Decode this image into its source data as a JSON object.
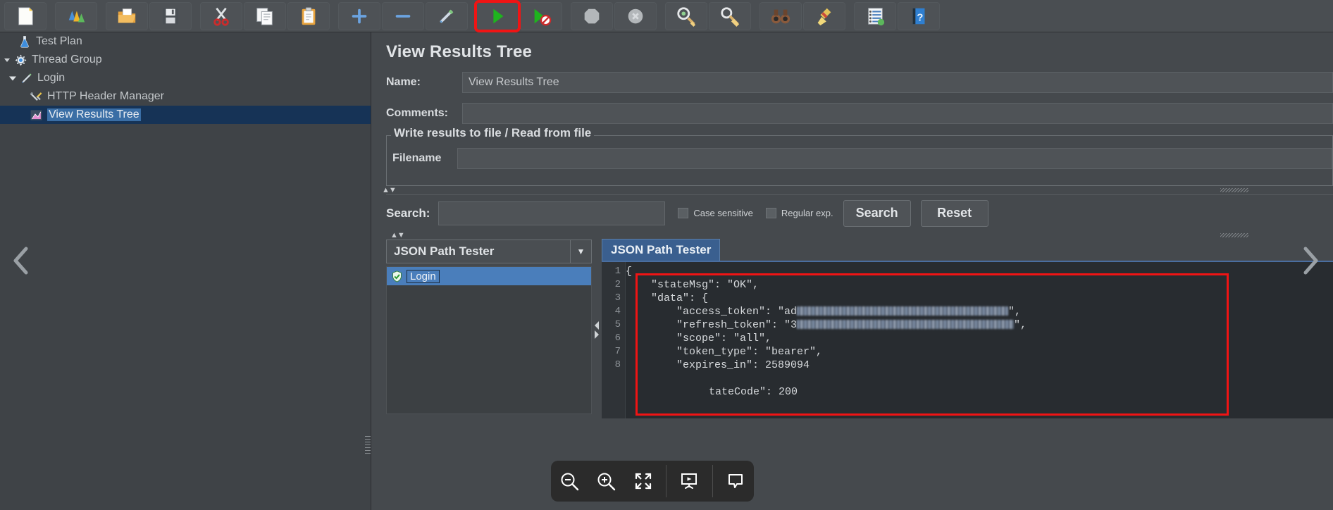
{
  "toolbar": {
    "buttons": [
      {
        "name": "new-test-plan",
        "icon": "new-document-icon"
      },
      {
        "name": "templates",
        "icon": "templates-icon"
      },
      {
        "name": "open",
        "icon": "open-folder-icon"
      },
      {
        "name": "save",
        "icon": "save-disk-icon"
      },
      {
        "name": "cut",
        "icon": "scissors-icon"
      },
      {
        "name": "copy",
        "icon": "copy-icon"
      },
      {
        "name": "paste",
        "icon": "clipboard-icon"
      },
      {
        "name": "expand-all",
        "icon": "plus-icon"
      },
      {
        "name": "collapse-all",
        "icon": "minus-icon"
      },
      {
        "name": "toggle",
        "icon": "toggle-pencil-icon"
      },
      {
        "name": "start",
        "icon": "play-green-icon",
        "highlighted": true
      },
      {
        "name": "start-no-pauses",
        "icon": "play-no-pauses-icon"
      },
      {
        "name": "stop",
        "icon": "stop-octagon-icon"
      },
      {
        "name": "shutdown",
        "icon": "shutdown-circle-icon"
      },
      {
        "name": "clear",
        "icon": "clear-broom-icon"
      },
      {
        "name": "clear-all",
        "icon": "clear-all-broom-icon"
      },
      {
        "name": "search",
        "icon": "binoculars-icon"
      },
      {
        "name": "reset-search",
        "icon": "broom-icon"
      },
      {
        "name": "function-helper",
        "icon": "function-list-icon"
      },
      {
        "name": "help",
        "icon": "help-book-icon"
      }
    ]
  },
  "tree": {
    "items": [
      {
        "label": "Test Plan",
        "icon": "test-plan-icon",
        "indent": 0,
        "twisty": "",
        "selected": false
      },
      {
        "label": "Thread Group",
        "icon": "thread-group-gear-icon",
        "indent": 0,
        "twisty": "down",
        "selected": false
      },
      {
        "label": "Login",
        "icon": "http-request-icon",
        "indent": 1,
        "twisty": "down",
        "selected": false
      },
      {
        "label": "HTTP Header Manager",
        "icon": "header-manager-icon",
        "indent": 2,
        "twisty": "",
        "selected": false
      },
      {
        "label": "View Results Tree",
        "icon": "view-results-tree-icon",
        "indent": 2,
        "twisty": "",
        "selected": true
      }
    ]
  },
  "panel": {
    "title": "View Results Tree",
    "name_label": "Name:",
    "name_value": "View Results Tree",
    "comments_label": "Comments:",
    "comments_value": "",
    "group_legend": "Write results to file / Read from file",
    "filename_label": "Filename",
    "filename_value": ""
  },
  "search": {
    "label": "Search:",
    "value": "",
    "case_sensitive_label": "Case sensitive",
    "case_sensitive_checked": false,
    "regular_exp_label": "Regular exp.",
    "regular_exp_checked": false,
    "search_button": "Search",
    "reset_button": "Reset"
  },
  "results": {
    "renderer_selected": "JSON Path Tester",
    "sampler_items": [
      {
        "label": "Login",
        "status": "success"
      }
    ],
    "tab_active": "JSON Path Tester"
  },
  "code": {
    "line_numbers": [
      "1",
      "2",
      "3",
      "4",
      "5",
      "6",
      "7",
      "8"
    ],
    "lines": [
      {
        "n": 1,
        "text": "{"
      },
      {
        "n": 2,
        "text": "    \"stateMsg\": \"OK\","
      },
      {
        "n": 3,
        "text": "    \"data\": {"
      },
      {
        "n": 4,
        "prefix": "        \"access_token\": \"ad",
        "redacted": true,
        "suffix": "\","
      },
      {
        "n": 5,
        "prefix": "        \"refresh_token\": \"3",
        "redacted": true,
        "suffix": "\","
      },
      {
        "n": 6,
        "text": "        \"scope\": \"all\","
      },
      {
        "n": 7,
        "text": "        \"token_type\": \"bearer\","
      },
      {
        "n": 8,
        "text": "        \"expires_in\": 2589094"
      }
    ],
    "trailing_line": "tateCode\": 200"
  },
  "media_toolbar": {
    "buttons": [
      {
        "name": "zoom-out-icon",
        "label": "zoom out"
      },
      {
        "name": "zoom-in-icon",
        "label": "zoom in"
      },
      {
        "name": "fullscreen-icon",
        "label": "fullscreen"
      },
      {
        "name": "present-icon",
        "label": "present"
      },
      {
        "name": "comment-icon",
        "label": "comment"
      }
    ]
  },
  "nav": {
    "prev": "chevron-left-icon",
    "next": "chevron-right-icon"
  },
  "colors": {
    "highlight_red": "#f01414",
    "selection_blue": "#3a6ea5",
    "panel_bg": "#45494d",
    "code_bg": "#282c30"
  }
}
